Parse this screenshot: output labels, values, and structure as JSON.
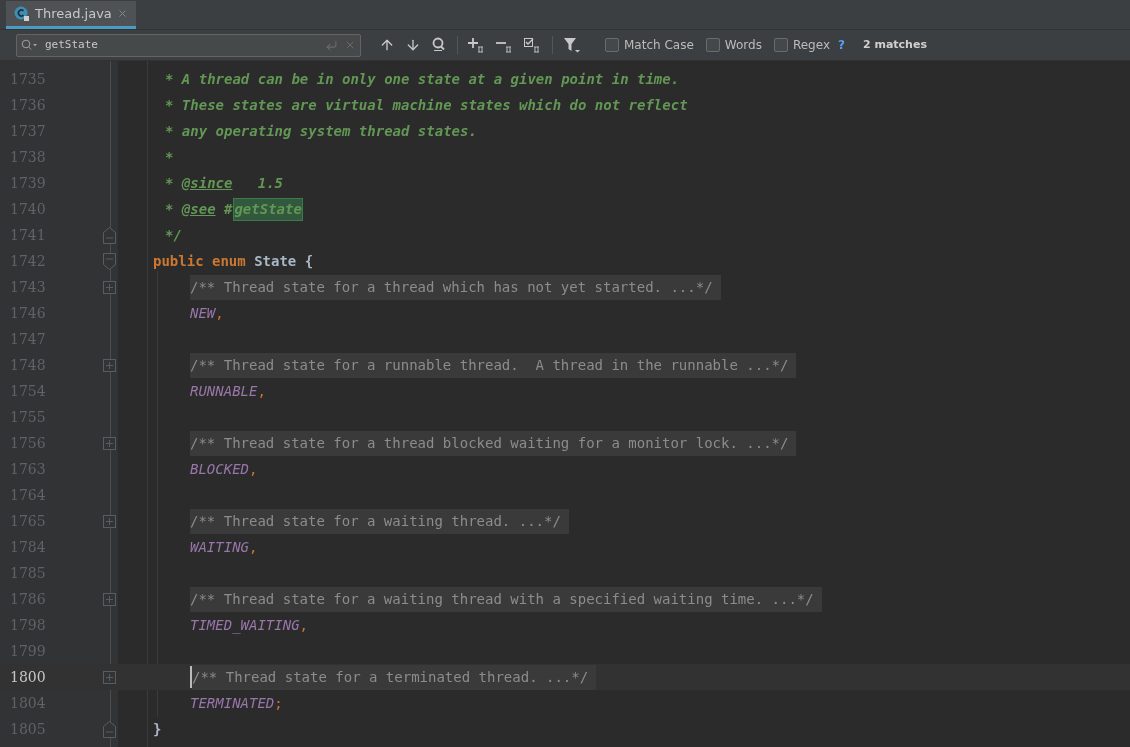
{
  "tab": {
    "label": "Thread.java",
    "selected": true
  },
  "find_bar": {
    "value": "getState",
    "options": [
      {
        "label": "Match Case",
        "checked": false
      },
      {
        "label": "Words",
        "checked": false
      },
      {
        "label": "Regex",
        "checked": false
      }
    ],
    "help": "?",
    "matches": "2 matches"
  },
  "lines": [
    {
      "number": "1735",
      "kind": "doc",
      "current": false,
      "tokens": [
        {
          "kind": "doc",
          "text": "* A thread can be in only one state at a given point in time."
        }
      ]
    },
    {
      "number": "1736",
      "kind": "doc",
      "current": false,
      "tokens": [
        {
          "kind": "doc",
          "text": "* These states are virtual machine states which do not reflect"
        }
      ]
    },
    {
      "number": "1737",
      "kind": "doc",
      "current": false,
      "tokens": [
        {
          "kind": "doc",
          "text": "* any operating system thread states."
        }
      ]
    },
    {
      "number": "1738",
      "kind": "doc",
      "current": false,
      "tokens": [
        {
          "kind": "doc",
          "text": "*"
        }
      ]
    },
    {
      "number": "1739",
      "kind": "doc",
      "current": false,
      "tokens": [
        {
          "kind": "doc",
          "text": "* "
        },
        {
          "kind": "tag",
          "text": "@since"
        },
        {
          "kind": "doc",
          "text": "   1.5"
        }
      ]
    },
    {
      "number": "1740",
      "kind": "doc",
      "current": false,
      "tokens": [
        {
          "kind": "doc",
          "text": "* "
        },
        {
          "kind": "tag",
          "text": "@see"
        },
        {
          "kind": "doc",
          "text": " #"
        },
        {
          "kind": "match",
          "text": "getState"
        }
      ]
    },
    {
      "number": "1741",
      "kind": "doc",
      "fold": {
        "kind": "end"
      },
      "current": false,
      "tokens": [
        {
          "kind": "doc",
          "text": "*/"
        }
      ]
    },
    {
      "number": "1742",
      "kind": "top",
      "fold": {
        "kind": "start"
      },
      "current": false,
      "tokens": [
        {
          "kind": "keyword",
          "text": "public enum "
        },
        {
          "kind": "ident",
          "text": "State {"
        }
      ]
    },
    {
      "number": "1743",
      "kind": "member",
      "fold": {
        "kind": "collapsed"
      },
      "current": false,
      "tokens": [
        {
          "kind": "fold",
          "text": "/** Thread state for a thread which has not yet started. ...*/"
        }
      ]
    },
    {
      "number": "1746",
      "kind": "member",
      "current": false,
      "tokens": [
        {
          "kind": "constant",
          "text": "NEW"
        },
        {
          "kind": "punct",
          "text": ","
        }
      ]
    },
    {
      "number": "1747",
      "kind": "member",
      "current": false
    },
    {
      "number": "1748",
      "kind": "member",
      "fold": {
        "kind": "collapsed"
      },
      "current": false,
      "tokens": [
        {
          "kind": "fold",
          "text": "/** Thread state for a runnable thread.  A thread in the runnable ...*/"
        }
      ]
    },
    {
      "number": "1754",
      "kind": "member",
      "current": false,
      "tokens": [
        {
          "kind": "constant",
          "text": "RUNNABLE"
        },
        {
          "kind": "punct",
          "text": ","
        }
      ]
    },
    {
      "number": "1755",
      "kind": "member",
      "current": false
    },
    {
      "number": "1756",
      "kind": "member",
      "fold": {
        "kind": "collapsed"
      },
      "current": false,
      "tokens": [
        {
          "kind": "fold",
          "text": "/** Thread state for a thread blocked waiting for a monitor lock. ...*/"
        }
      ]
    },
    {
      "number": "1763",
      "kind": "member",
      "current": false,
      "tokens": [
        {
          "kind": "constant",
          "text": "BLOCKED"
        },
        {
          "kind": "punct",
          "text": ","
        }
      ]
    },
    {
      "number": "1764",
      "kind": "member",
      "current": false
    },
    {
      "number": "1765",
      "kind": "member",
      "fold": {
        "kind": "collapsed"
      },
      "current": false,
      "tokens": [
        {
          "kind": "fold",
          "text": "/** Thread state for a waiting thread. ...*/"
        }
      ]
    },
    {
      "number": "1784",
      "kind": "member",
      "current": false,
      "tokens": [
        {
          "kind": "constant",
          "text": "WAITING"
        },
        {
          "kind": "punct",
          "text": ","
        }
      ]
    },
    {
      "number": "1785",
      "kind": "member",
      "current": false
    },
    {
      "number": "1786",
      "kind": "member",
      "fold": {
        "kind": "collapsed"
      },
      "current": false,
      "tokens": [
        {
          "kind": "fold",
          "text": "/** Thread state for a waiting thread with a specified waiting time. ...*/"
        }
      ]
    },
    {
      "number": "1798",
      "kind": "member",
      "current": false,
      "tokens": [
        {
          "kind": "constant",
          "text": "TIMED_WAITING"
        },
        {
          "kind": "punct",
          "text": ","
        }
      ]
    },
    {
      "number": "1799",
      "kind": "member",
      "current": false
    },
    {
      "number": "1800",
      "kind": "member",
      "fold": {
        "kind": "collapsed"
      },
      "current": true,
      "tokens": [
        {
          "kind": "fold",
          "text": "/** Thread state for a terminated thread. ...*/"
        }
      ]
    },
    {
      "number": "1804",
      "kind": "member",
      "current": false,
      "tokens": [
        {
          "kind": "constant",
          "text": "TERMINATED"
        },
        {
          "kind": "punct",
          "text": ";"
        }
      ]
    },
    {
      "number": "1805",
      "kind": "top",
      "fold": {
        "kind": "end"
      },
      "current": false,
      "tokens": [
        {
          "kind": "ident",
          "text": "}"
        }
      ]
    }
  ]
}
